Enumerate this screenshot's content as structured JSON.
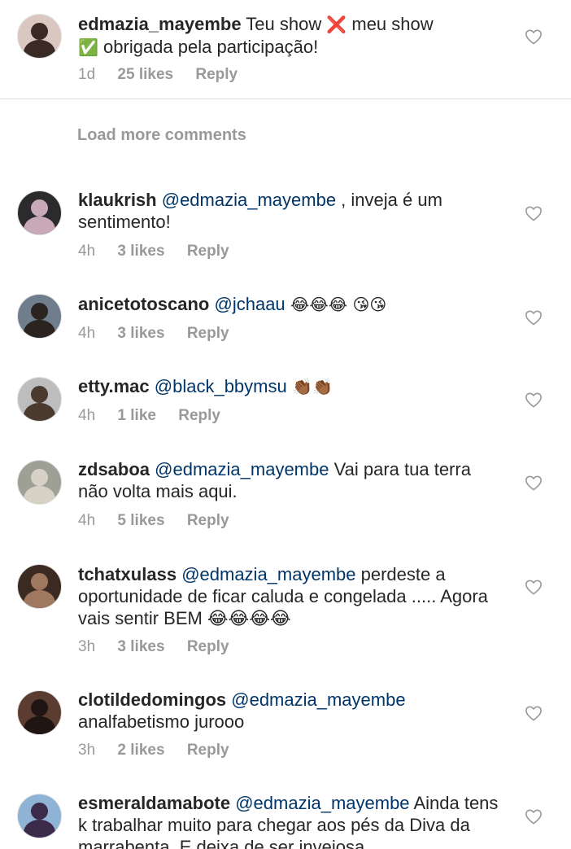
{
  "load_more": "Load more comments",
  "reply_label": "Reply",
  "comments": [
    {
      "username": "edmazia_mayembe",
      "mention": "",
      "parts": [
        "Teu show ",
        "❌",
        " meu show ",
        "✅",
        " obrigada pela participação!"
      ],
      "time": "1d",
      "likes": "25 likes",
      "avatar_bg": "#d9c7c0",
      "avatar_fg": "#3a2a25"
    },
    {
      "username": "klaukrish",
      "mention": "@edmazia_mayembe",
      "parts": [
        " , inveja é um sentimento!"
      ],
      "time": "4h",
      "likes": "3 likes",
      "avatar_bg": "#2b2b2b",
      "avatar_fg": "#c9a8b8"
    },
    {
      "username": "anicetotoscano",
      "mention": "@jchaau",
      "parts": [
        " 😂😂😂 😘😘"
      ],
      "time": "4h",
      "likes": "3 likes",
      "avatar_bg": "#6f7d8c",
      "avatar_fg": "#2a2320"
    },
    {
      "username": "etty.mac",
      "mention": "@black_bbymsu",
      "parts": [
        " 👏🏾👏🏾"
      ],
      "time": "4h",
      "likes": "1 like",
      "avatar_bg": "#bdbdbd",
      "avatar_fg": "#4a3a30"
    },
    {
      "username": "zdsaboa",
      "mention": "@edmazia_mayembe",
      "parts": [
        " Vai para tua terra não volta mais aqui."
      ],
      "time": "4h",
      "likes": "5 likes",
      "avatar_bg": "#9ea095",
      "avatar_fg": "#d8d2c6"
    },
    {
      "username": "tchatxulass",
      "mention": "@edmazia_mayembe",
      "parts": [
        " perdeste a oportunidade de ficar caluda e congelada ..... Agora vais sentir BEM 😂😂😂😂"
      ],
      "time": "3h",
      "likes": "3 likes",
      "avatar_bg": "#3a2a22",
      "avatar_fg": "#a07860"
    },
    {
      "username": "clotildedomingos",
      "mention": "@edmazia_mayembe",
      "parts": [
        " analfabetismo jurooo"
      ],
      "time": "3h",
      "likes": "2 likes",
      "avatar_bg": "#5a3d30",
      "avatar_fg": "#1f1512"
    },
    {
      "username": "esmeraldamabote",
      "mention": "@edmazia_mayembe",
      "parts": [
        " Ainda tens k trabalhar muito para chegar aos pés da Diva da marrabenta. E deixa de ser invejosa"
      ],
      "time": "",
      "likes": "",
      "avatar_bg": "#8fb3d4",
      "avatar_fg": "#3b2a4a"
    }
  ]
}
